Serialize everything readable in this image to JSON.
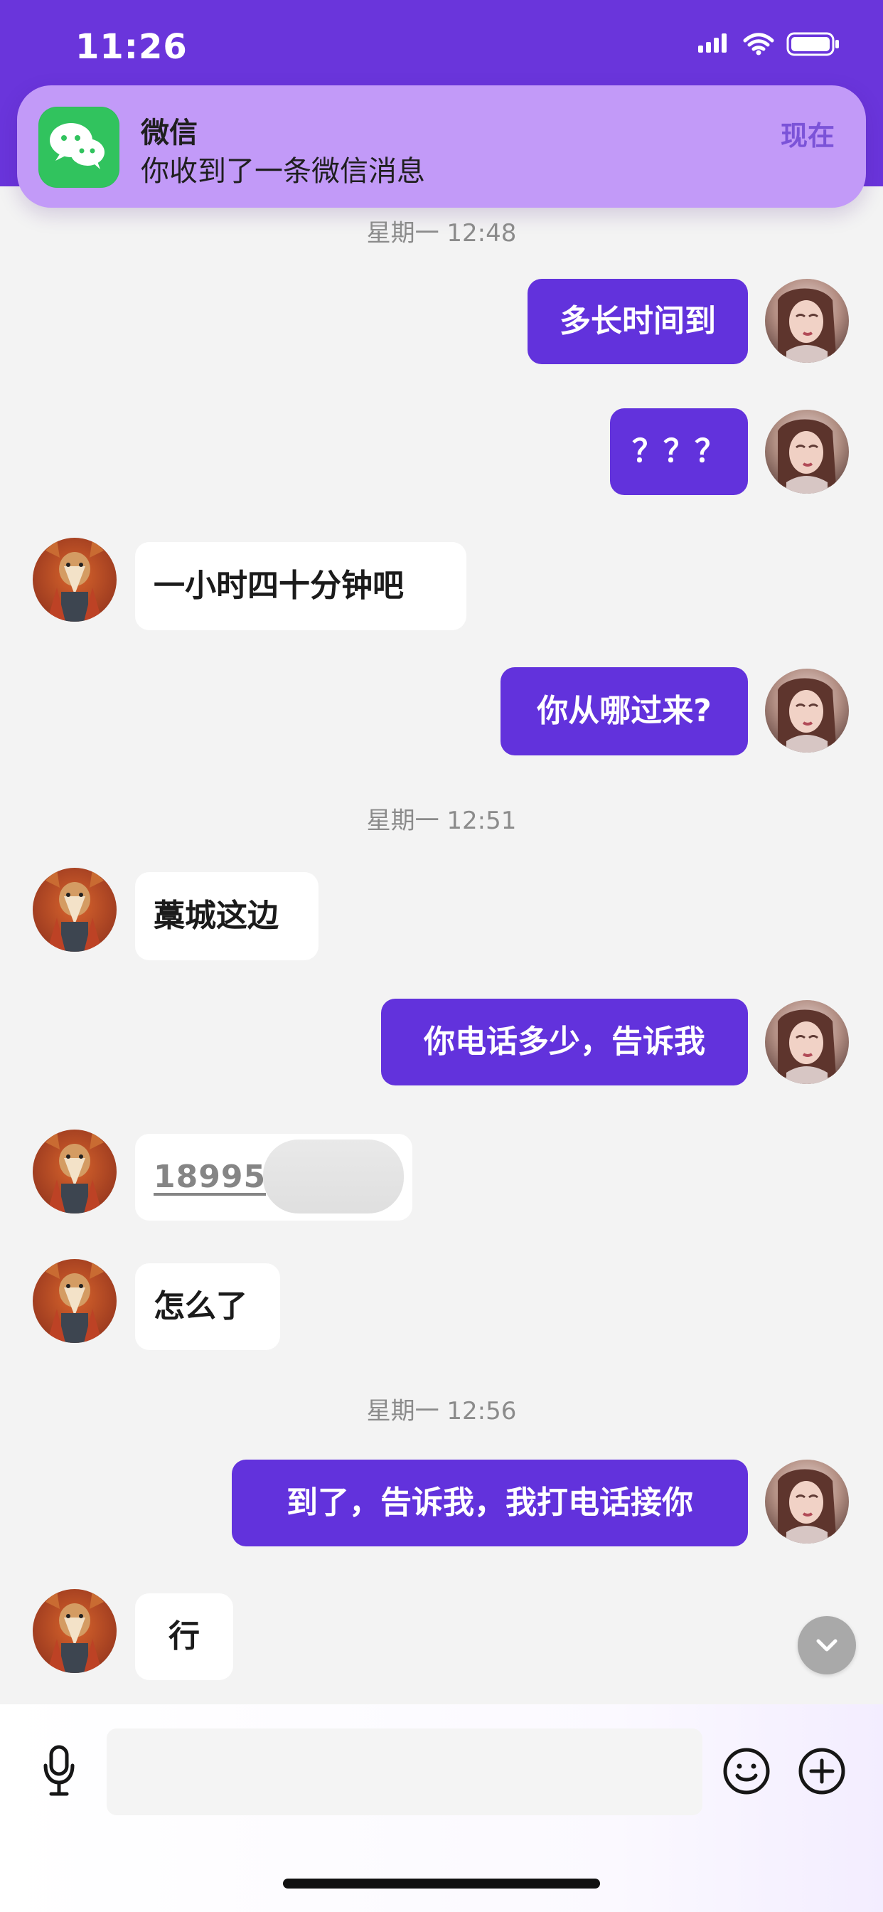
{
  "status_bar": {
    "time": "11:26"
  },
  "notification": {
    "app_name": "微信",
    "message": "你收到了一条微信消息",
    "time": "现在",
    "accent": "#c29af8"
  },
  "chat": {
    "timestamps": [
      "星期一 12:48",
      "星期一 12:51",
      "星期一 12:56"
    ],
    "messages": [
      {
        "side": "right",
        "text": "多长时间到"
      },
      {
        "side": "right",
        "text": "？？？"
      },
      {
        "side": "left",
        "text": "一小时四十分钟吧"
      },
      {
        "side": "right",
        "text": "你从哪过来?"
      },
      {
        "side": "left",
        "text": "藁城这边"
      },
      {
        "side": "right",
        "text": "你电话多少，告诉我"
      },
      {
        "side": "left",
        "text": "18995"
      },
      {
        "side": "left",
        "text": "怎么了"
      },
      {
        "side": "right",
        "text": "到了，告诉我，我打电话接你"
      },
      {
        "side": "left",
        "text": "行"
      }
    ]
  },
  "input_bar": {
    "placeholder": ""
  },
  "colors": {
    "top_bar": "#6a35db",
    "right_bubble": "#6232dc",
    "left_bubble": "#ffffff",
    "chat_background": "#f3f3f3"
  }
}
